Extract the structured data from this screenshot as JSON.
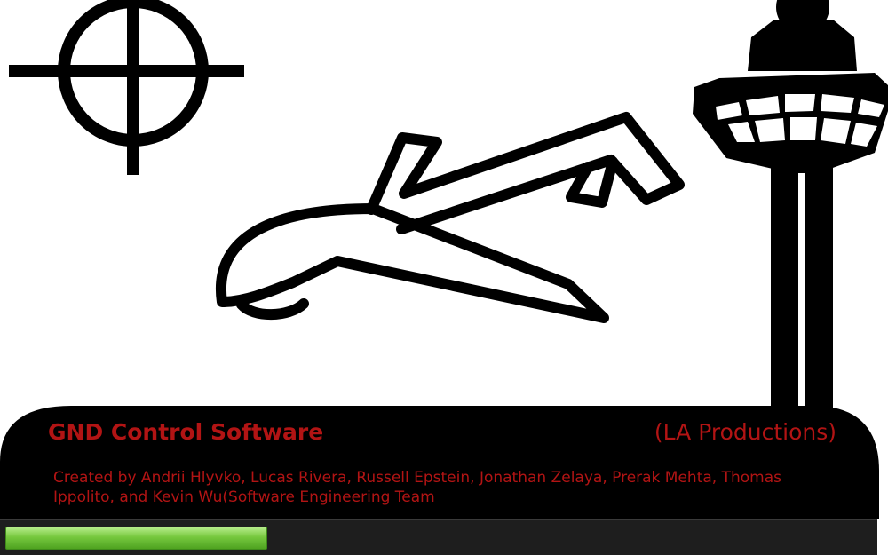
{
  "splash": {
    "title": "GND Control Software",
    "company": "(LA Productions)",
    "credits": "Created by Andrii Hlyvko, Lucas Rivera, Russell Epstein, Jonathan Zelaya, Prerak Mehta, Thomas Ippolito, and Kevin Wu(Software Engineering Team"
  },
  "icons": [
    "crosshair-icon",
    "drone-icon",
    "control-tower-icon"
  ],
  "progress": {
    "fraction": 0.3,
    "color": "#76c83e"
  },
  "colors": {
    "text_accent": "#b21414",
    "panel": "#000000",
    "track": "#1e1e1e"
  }
}
